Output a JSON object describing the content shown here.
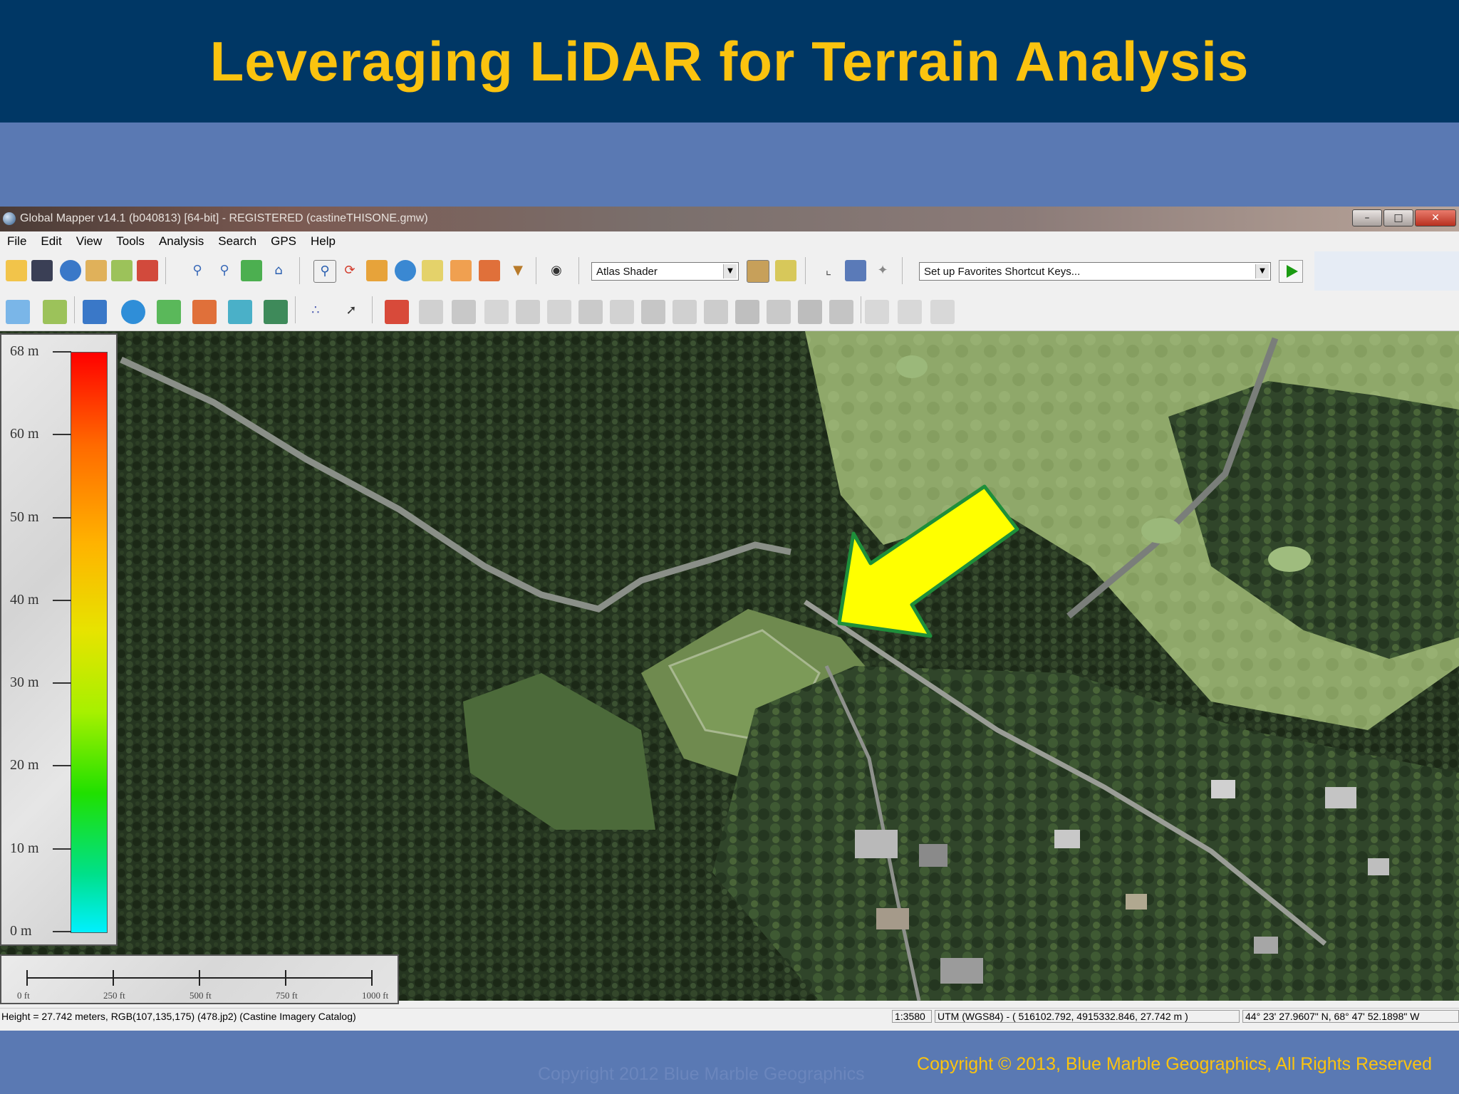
{
  "slide": {
    "title": "Leveraging LiDAR for Terrain Analysis",
    "copyright": "Copyright © 2013, Blue Marble Geographics, All Rights Reserved",
    "watermark": "Copyright 2012 Blue Marble Geographics"
  },
  "window": {
    "title": "Global Mapper v14.1 (b040813) [64-bit] - REGISTERED (castineTHISONE.gmw)",
    "controls": [
      "minimize",
      "maximize",
      "close"
    ]
  },
  "menu": [
    "File",
    "Edit",
    "View",
    "Tools",
    "Analysis",
    "Search",
    "GPS",
    "Help"
  ],
  "toolbar": {
    "shader_select": "Atlas Shader",
    "favorites_select": "Set up Favorites Shortcut Keys...",
    "run_button": "play-icon"
  },
  "legend": {
    "labels": [
      "68 m",
      "60 m",
      "50 m",
      "40 m",
      "30 m",
      "20 m",
      "10 m",
      "0 m"
    ],
    "max_value_m": 68,
    "min_value_m": 0
  },
  "scale_bar": {
    "labels": [
      "0 ft",
      "250 ft",
      "500 ft",
      "750 ft",
      "1000 ft"
    ]
  },
  "map": {
    "callout": "yellow-arrow-icon",
    "colors": {
      "arrow_fill": "#ffff00",
      "arrow_stroke": "#1e8f3a",
      "forest": "#243320",
      "field": "#8fa86a"
    }
  },
  "status": {
    "info": "Height = 27.742 meters, RGB(107,135,175) (478.jp2) (Castine Imagery Catalog)",
    "scale": "1:3580",
    "projection": "UTM (WGS84) - ( 516102.792, 4915332.846, 27.742 m )",
    "latlon": "44° 23' 27.9607\" N, 68° 47' 52.1898\" W"
  }
}
